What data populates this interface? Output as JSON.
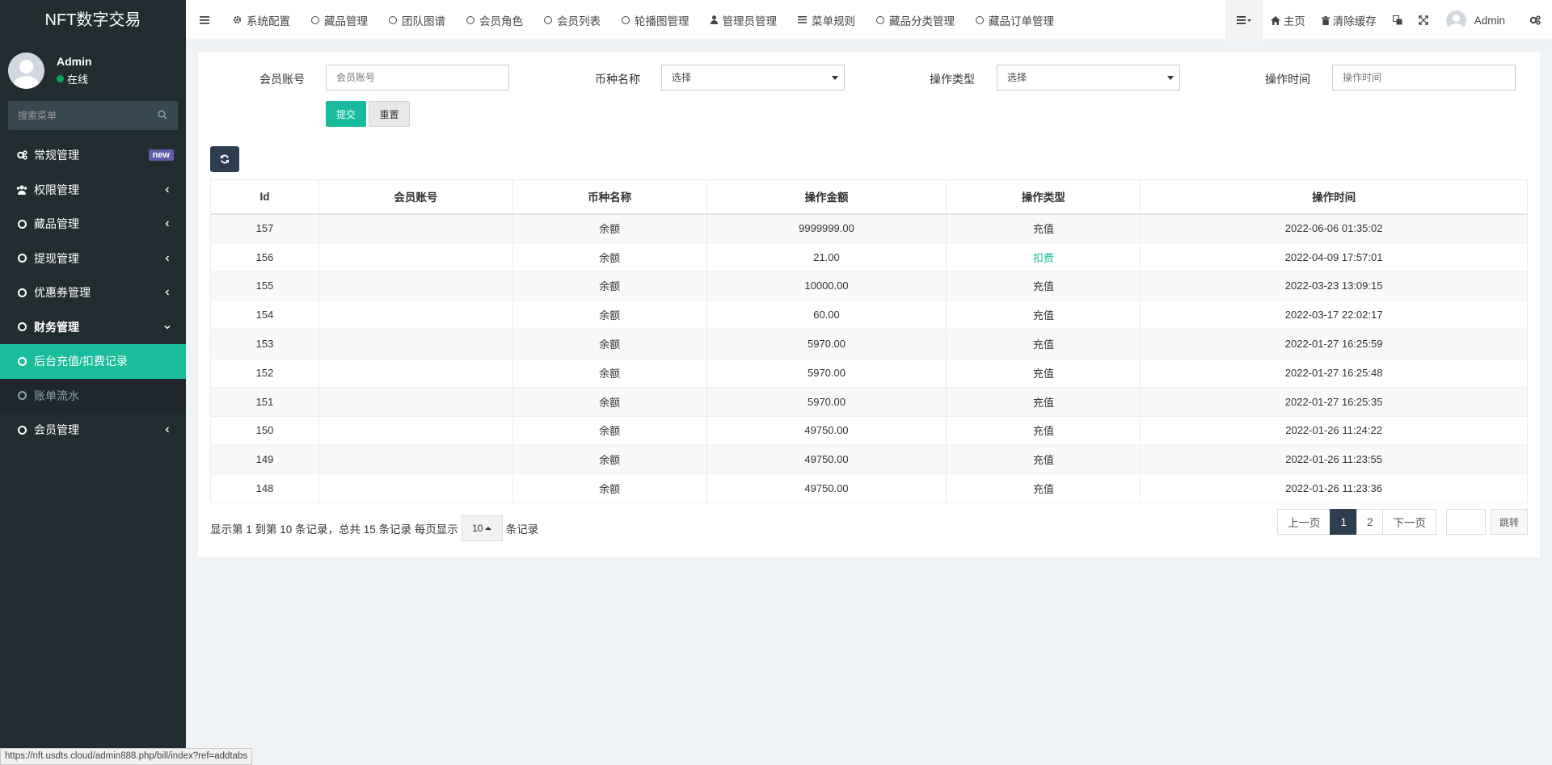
{
  "brand": "NFT数字交易",
  "user": {
    "name": "Admin",
    "status": "在线"
  },
  "sidebar": {
    "search_placeholder": "搜索菜单",
    "items": [
      {
        "label": "常规管理",
        "icon": "cogs-icon",
        "badge": "new"
      },
      {
        "label": "权限管理",
        "icon": "users-icon"
      },
      {
        "label": "藏品管理",
        "icon": "circle-o-icon"
      },
      {
        "label": "提现管理",
        "icon": "circle-o-icon"
      },
      {
        "label": "优惠券管理",
        "icon": "circle-o-icon"
      },
      {
        "label": "财务管理",
        "icon": "circle-o-icon"
      },
      {
        "label": "后台充值/扣费记录",
        "icon": "circle-o-icon"
      },
      {
        "label": "账单流水",
        "icon": "circle-o-icon"
      },
      {
        "label": "会员管理",
        "icon": "circle-o-icon"
      }
    ]
  },
  "topnav": {
    "tabs": [
      "系统配置",
      "藏品管理",
      "团队图谱",
      "会员角色",
      "会员列表",
      "轮播图管理",
      "管理员管理",
      "菜单规则",
      "藏品分类管理",
      "藏品订单管理"
    ],
    "right": {
      "home": "主页",
      "clear_cache": "清除缓存",
      "admin": "Admin"
    }
  },
  "filter": {
    "account_label": "会员账号",
    "account_placeholder": "会员账号",
    "currency_label": "币种名称",
    "currency_value": "选择",
    "optype_label": "操作类型",
    "optype_value": "选择",
    "optime_label": "操作时间",
    "optime_placeholder": "操作时间",
    "submit": "提交",
    "reset": "重置"
  },
  "table": {
    "headers": [
      "Id",
      "会员账号",
      "币种名称",
      "操作金额",
      "操作类型",
      "操作时间"
    ],
    "rows": [
      {
        "id": "157",
        "account": "",
        "currency": "余额",
        "amount": "9999999.00",
        "type": "充值",
        "time": "2022-06-06 01:35:02"
      },
      {
        "id": "156",
        "account": "",
        "currency": "余额",
        "amount": "21.00",
        "type": "扣费",
        "time": "2022-04-09 17:57:01"
      },
      {
        "id": "155",
        "account": "",
        "currency": "余额",
        "amount": "10000.00",
        "type": "充值",
        "time": "2022-03-23 13:09:15"
      },
      {
        "id": "154",
        "account": "",
        "currency": "余额",
        "amount": "60.00",
        "type": "充值",
        "time": "2022-03-17 22:02:17"
      },
      {
        "id": "153",
        "account": "",
        "currency": "余额",
        "amount": "5970.00",
        "type": "充值",
        "time": "2022-01-27 16:25:59"
      },
      {
        "id": "152",
        "account": "",
        "currency": "余额",
        "amount": "5970.00",
        "type": "充值",
        "time": "2022-01-27 16:25:48"
      },
      {
        "id": "151",
        "account": "",
        "currency": "余额",
        "amount": "5970.00",
        "type": "充值",
        "time": "2022-01-27 16:25:35"
      },
      {
        "id": "150",
        "account": "",
        "currency": "余额",
        "amount": "49750.00",
        "type": "充值",
        "time": "2022-01-26 11:24:22"
      },
      {
        "id": "149",
        "account": "",
        "currency": "余额",
        "amount": "49750.00",
        "type": "充值",
        "time": "2022-01-26 11:23:55"
      },
      {
        "id": "148",
        "account": "",
        "currency": "余额",
        "amount": "49750.00",
        "type": "充值",
        "time": "2022-01-26 11:23:36"
      }
    ]
  },
  "pagination": {
    "info_prefix": "显示第 1 到第 10 条记录，总共 15 条记录 每页显示",
    "page_size": "10",
    "info_suffix": "条记录",
    "prev": "上一页",
    "pages": [
      "1",
      "2"
    ],
    "current": "1",
    "next": "下一页",
    "jump": "跳转"
  },
  "status_url": "https://nft.usdts.cloud/admin888.php/bill/index?ref=addtabs",
  "colors": {
    "sidebar_bg": "#222d32",
    "accent": "#18bc9c",
    "dark_btn": "#2c3e50",
    "badge_new": "#605ca8"
  }
}
